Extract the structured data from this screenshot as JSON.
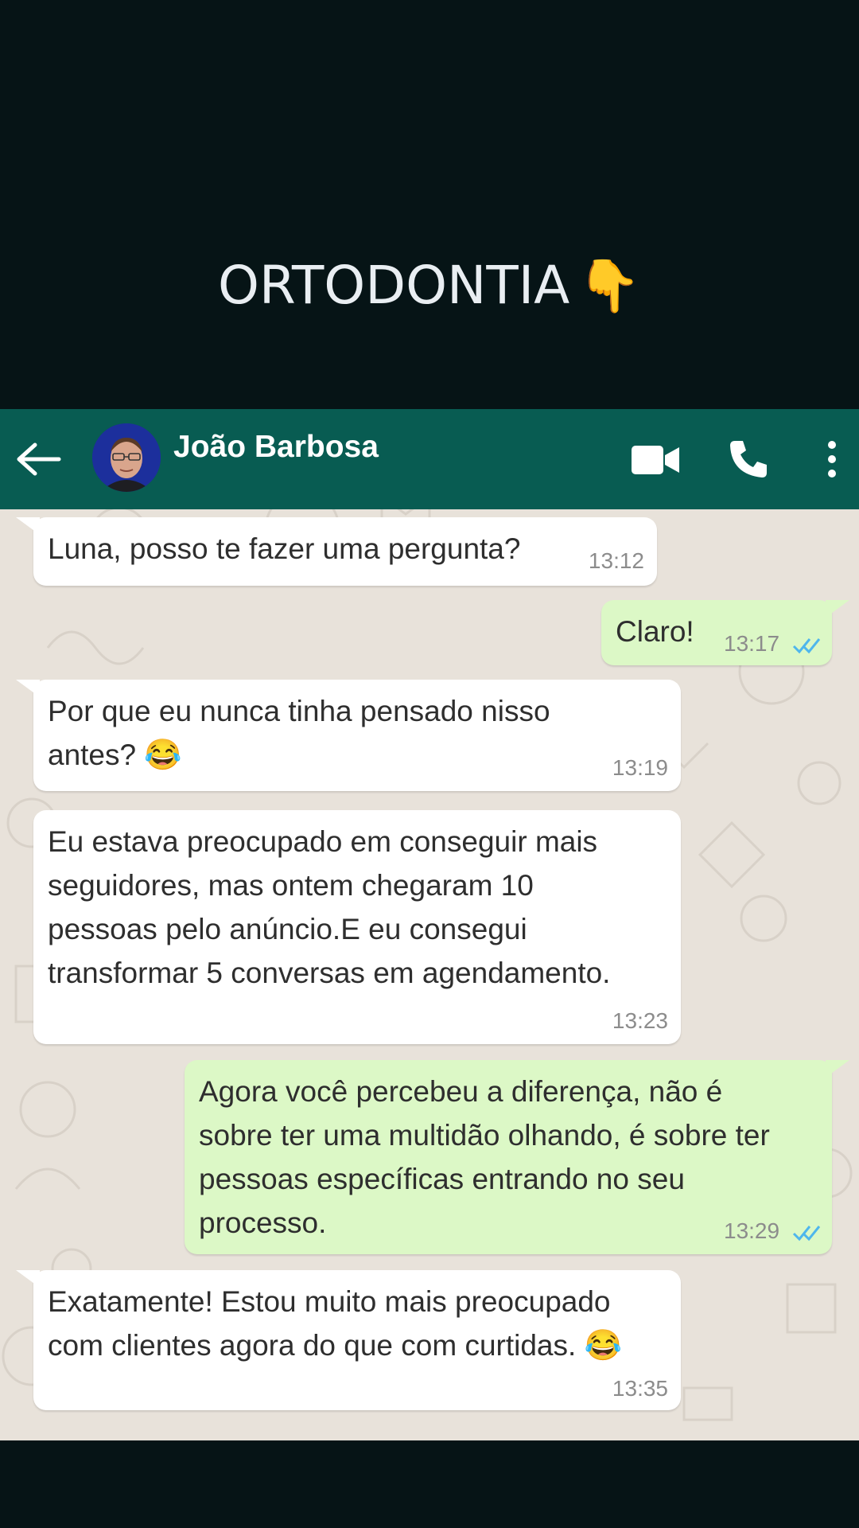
{
  "overlay": {
    "title": "ORTODONTIA",
    "pointer_emoji": "👇"
  },
  "header": {
    "contact_name": "João Barbosa",
    "icons": [
      "back-arrow-icon",
      "video-call-icon",
      "phone-icon",
      "more-options-icon"
    ]
  },
  "colors": {
    "header_bg": "#085c52",
    "incoming_bubble": "#ffffff",
    "outgoing_bubble": "#dcf8c6",
    "chat_bg": "#e8e2da",
    "read_ticks": "#4fb6ec"
  },
  "messages": [
    {
      "direction": "incoming",
      "lines": [
        "Luna, posso te fazer uma pergunta?"
      ],
      "time": "13:12"
    },
    {
      "direction": "outgoing",
      "lines": [
        "Claro!"
      ],
      "time": "13:17",
      "status": "read"
    },
    {
      "direction": "incoming",
      "lines": [
        "Por que eu nunca tinha pensado nisso",
        "antes?"
      ],
      "emoji": "😂",
      "time": "13:19"
    },
    {
      "direction": "incoming",
      "lines": [
        "Eu estava preocupado em conseguir mais",
        "seguidores, mas ontem chegaram 10",
        "pessoas pelo anúncio.E eu consegui",
        "transformar 5 conversas em agendamento."
      ],
      "time": "13:23"
    },
    {
      "direction": "outgoing",
      "lines": [
        "Agora você percebeu a diferença, não é",
        "sobre ter uma multidão olhando, é sobre ter",
        "pessoas específicas entrando no seu",
        "processo."
      ],
      "time": "13:29",
      "status": "read"
    },
    {
      "direction": "incoming",
      "lines": [
        "Exatamente! Estou muito mais preocupado",
        "com clientes agora do que com curtidas."
      ],
      "emoji": "😂",
      "time": "13:35"
    }
  ]
}
